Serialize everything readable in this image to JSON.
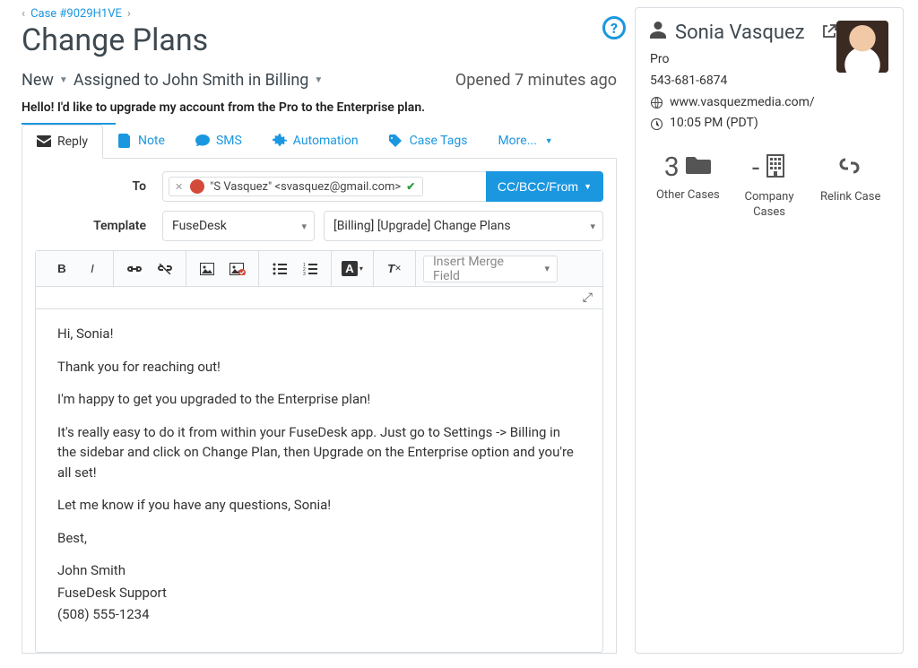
{
  "breadcrumb": {
    "case_label": "Case #9029H1VE"
  },
  "page": {
    "title": "Change Plans"
  },
  "status": {
    "state": "New",
    "assigned_text": "Assigned to John Smith in Billing",
    "opened_text": "Opened 7 minutes ago"
  },
  "customer_message": "Hello! I'd like to upgrade my account from the Pro to the Enterprise plan.",
  "tabs": {
    "reply": "Reply",
    "note": "Note",
    "sms": "SMS",
    "automation": "Automation",
    "case_tags": "Case Tags",
    "more": "More..."
  },
  "compose": {
    "to_label": "To",
    "to_chip": "\"S Vasquez\" <svasquez@gmail.com>",
    "cc_button": "CC/BCC/From",
    "template_label": "Template",
    "template_group": "FuseDesk",
    "template_selected": "[Billing] [Upgrade] Change Plans",
    "merge_placeholder": "Insert Merge Field"
  },
  "email_body": {
    "p1": "Hi, Sonia!",
    "p2": "Thank you for reaching out!",
    "p3": "I'm happy to get you upgraded to the Enterprise plan!",
    "p4": "It's really easy to do it from within your FuseDesk app. Just go to Settings -> Billing in the sidebar and click on Change Plan, then Upgrade on the Enterprise option and you're all set!",
    "p5": "Let me know if you have any questions, Sonia!",
    "p6": "Best,",
    "sig1": "John Smith",
    "sig2": "FuseDesk Support",
    "sig3": "(508) 555-1234"
  },
  "contact": {
    "name": "Sonia Vasquez",
    "plan": "Pro",
    "phone": "543-681-6874",
    "website": "www.vasquezmedia.com/",
    "local_time": "10:05 PM (PDT)"
  },
  "stats": {
    "other_cases_count": "3",
    "other_cases_label": "Other Cases",
    "company_cases_count": "-",
    "company_cases_label": "Company Cases",
    "relink_label": "Relink Case"
  }
}
